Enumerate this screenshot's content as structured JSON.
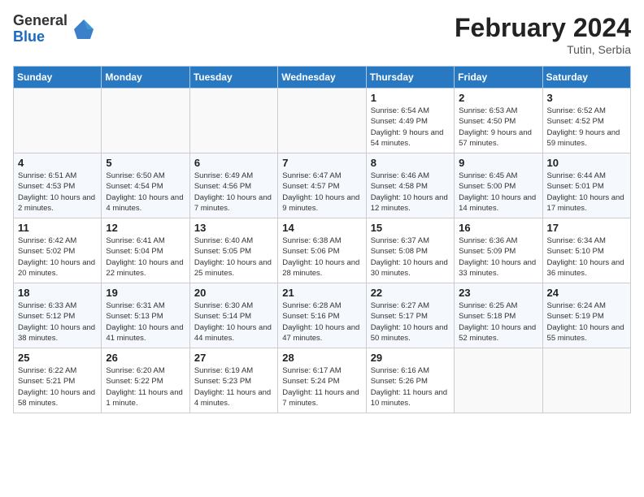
{
  "logo": {
    "general": "General",
    "blue": "Blue"
  },
  "title": "February 2024",
  "location": "Tutin, Serbia",
  "days_of_week": [
    "Sunday",
    "Monday",
    "Tuesday",
    "Wednesday",
    "Thursday",
    "Friday",
    "Saturday"
  ],
  "weeks": [
    [
      {
        "day": "",
        "info": ""
      },
      {
        "day": "",
        "info": ""
      },
      {
        "day": "",
        "info": ""
      },
      {
        "day": "",
        "info": ""
      },
      {
        "day": "1",
        "info": "Sunrise: 6:54 AM\nSunset: 4:49 PM\nDaylight: 9 hours and 54 minutes."
      },
      {
        "day": "2",
        "info": "Sunrise: 6:53 AM\nSunset: 4:50 PM\nDaylight: 9 hours and 57 minutes."
      },
      {
        "day": "3",
        "info": "Sunrise: 6:52 AM\nSunset: 4:52 PM\nDaylight: 9 hours and 59 minutes."
      }
    ],
    [
      {
        "day": "4",
        "info": "Sunrise: 6:51 AM\nSunset: 4:53 PM\nDaylight: 10 hours and 2 minutes."
      },
      {
        "day": "5",
        "info": "Sunrise: 6:50 AM\nSunset: 4:54 PM\nDaylight: 10 hours and 4 minutes."
      },
      {
        "day": "6",
        "info": "Sunrise: 6:49 AM\nSunset: 4:56 PM\nDaylight: 10 hours and 7 minutes."
      },
      {
        "day": "7",
        "info": "Sunrise: 6:47 AM\nSunset: 4:57 PM\nDaylight: 10 hours and 9 minutes."
      },
      {
        "day": "8",
        "info": "Sunrise: 6:46 AM\nSunset: 4:58 PM\nDaylight: 10 hours and 12 minutes."
      },
      {
        "day": "9",
        "info": "Sunrise: 6:45 AM\nSunset: 5:00 PM\nDaylight: 10 hours and 14 minutes."
      },
      {
        "day": "10",
        "info": "Sunrise: 6:44 AM\nSunset: 5:01 PM\nDaylight: 10 hours and 17 minutes."
      }
    ],
    [
      {
        "day": "11",
        "info": "Sunrise: 6:42 AM\nSunset: 5:02 PM\nDaylight: 10 hours and 20 minutes."
      },
      {
        "day": "12",
        "info": "Sunrise: 6:41 AM\nSunset: 5:04 PM\nDaylight: 10 hours and 22 minutes."
      },
      {
        "day": "13",
        "info": "Sunrise: 6:40 AM\nSunset: 5:05 PM\nDaylight: 10 hours and 25 minutes."
      },
      {
        "day": "14",
        "info": "Sunrise: 6:38 AM\nSunset: 5:06 PM\nDaylight: 10 hours and 28 minutes."
      },
      {
        "day": "15",
        "info": "Sunrise: 6:37 AM\nSunset: 5:08 PM\nDaylight: 10 hours and 30 minutes."
      },
      {
        "day": "16",
        "info": "Sunrise: 6:36 AM\nSunset: 5:09 PM\nDaylight: 10 hours and 33 minutes."
      },
      {
        "day": "17",
        "info": "Sunrise: 6:34 AM\nSunset: 5:10 PM\nDaylight: 10 hours and 36 minutes."
      }
    ],
    [
      {
        "day": "18",
        "info": "Sunrise: 6:33 AM\nSunset: 5:12 PM\nDaylight: 10 hours and 38 minutes."
      },
      {
        "day": "19",
        "info": "Sunrise: 6:31 AM\nSunset: 5:13 PM\nDaylight: 10 hours and 41 minutes."
      },
      {
        "day": "20",
        "info": "Sunrise: 6:30 AM\nSunset: 5:14 PM\nDaylight: 10 hours and 44 minutes."
      },
      {
        "day": "21",
        "info": "Sunrise: 6:28 AM\nSunset: 5:16 PM\nDaylight: 10 hours and 47 minutes."
      },
      {
        "day": "22",
        "info": "Sunrise: 6:27 AM\nSunset: 5:17 PM\nDaylight: 10 hours and 50 minutes."
      },
      {
        "day": "23",
        "info": "Sunrise: 6:25 AM\nSunset: 5:18 PM\nDaylight: 10 hours and 52 minutes."
      },
      {
        "day": "24",
        "info": "Sunrise: 6:24 AM\nSunset: 5:19 PM\nDaylight: 10 hours and 55 minutes."
      }
    ],
    [
      {
        "day": "25",
        "info": "Sunrise: 6:22 AM\nSunset: 5:21 PM\nDaylight: 10 hours and 58 minutes."
      },
      {
        "day": "26",
        "info": "Sunrise: 6:20 AM\nSunset: 5:22 PM\nDaylight: 11 hours and 1 minute."
      },
      {
        "day": "27",
        "info": "Sunrise: 6:19 AM\nSunset: 5:23 PM\nDaylight: 11 hours and 4 minutes."
      },
      {
        "day": "28",
        "info": "Sunrise: 6:17 AM\nSunset: 5:24 PM\nDaylight: 11 hours and 7 minutes."
      },
      {
        "day": "29",
        "info": "Sunrise: 6:16 AM\nSunset: 5:26 PM\nDaylight: 11 hours and 10 minutes."
      },
      {
        "day": "",
        "info": ""
      },
      {
        "day": "",
        "info": ""
      }
    ]
  ]
}
